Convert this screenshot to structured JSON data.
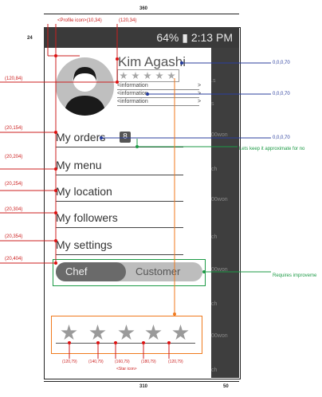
{
  "dimensions": {
    "top_width": "360",
    "bottom_width": "310",
    "bottom_right_width": "50",
    "left_height": "24"
  },
  "status_bar": {
    "text": "64% ▮ 2:13 PM"
  },
  "profile": {
    "name": "Kim Agashi",
    "info_lines": [
      "<information",
      "<information",
      "<information"
    ],
    "info_arrows": [
      ">",
      ">",
      ">"
    ]
  },
  "menu": {
    "orders": "My orders",
    "orders_count": "8",
    "menu": "My menu",
    "location": "My location",
    "followers": "My followers",
    "settings": "My settings"
  },
  "toggle": {
    "left": "Chef",
    "right": "Customer"
  },
  "right_panel": [
    ".s",
    "s",
    "s",
    "00won",
    "ch",
    "00won",
    "ch",
    "00won",
    "ch",
    "00won",
    "ch"
  ],
  "annotations": {
    "profile_icon": "<Profile icon>(10,34)",
    "name_coord": "(120,34)",
    "stars_coord": "(120,84)",
    "orders_coord": "(20,154)",
    "menu_coord": "(20,204)",
    "location_coord": "(20,254)",
    "followers_coord": "(20,304)",
    "settings_coord": "(20,354)",
    "toggle_coord": "(20,404)",
    "color_name": "0,0,0,70",
    "color_info": "0,0,0,70",
    "color_orders": "0,0,0,70",
    "approx_note": "Lets keep it approximate for no",
    "improve_note": "Requires improveme",
    "star_icon": "<Star icon>",
    "star_coords": [
      "(120,79)",
      "(140,79)",
      "(160,79)",
      "(180,79)",
      "(120,79)"
    ]
  },
  "colors": {
    "red": "#cc1f1f",
    "blue": "#2b3f9e",
    "green": "#1c9a45",
    "orange": "#f07a1e"
  },
  "icons": [
    "avatar-icon",
    "star-icon",
    "battery-icon"
  ]
}
